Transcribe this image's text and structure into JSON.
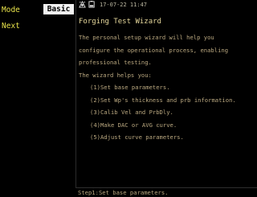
{
  "left_menu": {
    "mode_label": "Mode",
    "next_label": "Next",
    "tab_label": "Basic"
  },
  "status": {
    "datetime": "17-07-22 11:47",
    "icons": [
      "network-icon",
      "battery-icon"
    ]
  },
  "wizard": {
    "title": "Forging Test Wizard",
    "intro_lines": [
      "The personal setup wizard will help you",
      "configure the operational process, enabling",
      "professional testing."
    ],
    "helps_label": "The wizard helps you:",
    "steps": [
      "(1)Set base parameters.",
      "(2)Set Wp's thickness and prb information.",
      "(3)Calib Vel and PrbDly.",
      "(4)Make DAC or AVG curve.",
      "(5)Adjust curve parameters."
    ]
  },
  "footer": {
    "step_text": "Step1:Set base parameters."
  },
  "colors": {
    "yellow": "#e7e24a",
    "tan": "#b9a77f",
    "title": "#e5d79b",
    "background": "#000000"
  }
}
